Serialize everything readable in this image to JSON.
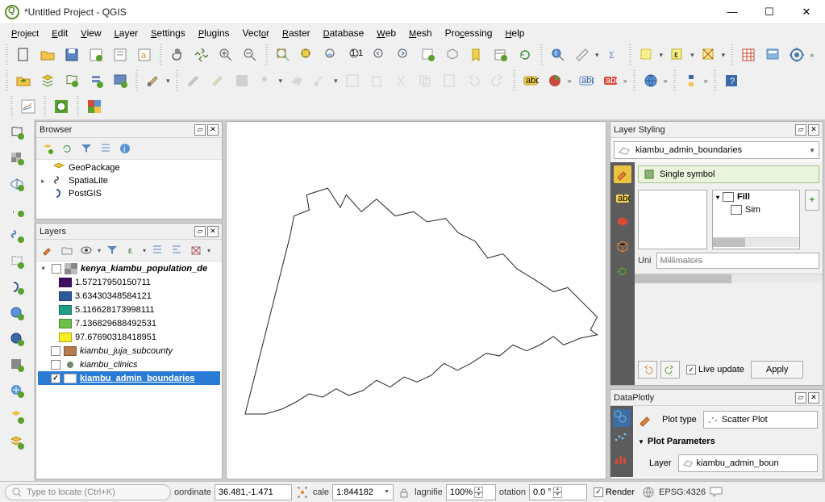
{
  "title": "*Untitled Project - QGIS",
  "menu": [
    "Project",
    "Edit",
    "View",
    "Layer",
    "Settings",
    "Plugins",
    "Vector",
    "Raster",
    "Database",
    "Web",
    "Mesh",
    "Processing",
    "Help"
  ],
  "browser": {
    "title": "Browser",
    "items": [
      {
        "icon": "geopackage",
        "label": "GeoPackage",
        "expandable": false
      },
      {
        "icon": "spatialite",
        "label": "SpatiaLite",
        "expandable": true
      },
      {
        "icon": "postgis",
        "label": "PostGIS",
        "expandable": false
      }
    ]
  },
  "layers": {
    "title": "Layers",
    "tree": [
      {
        "type": "group",
        "checked": false,
        "label": "kenya_kiambu_population_de",
        "style": "italic-bold",
        "icon": "raster"
      },
      {
        "type": "class",
        "color": "#3f1061",
        "label": "1.57217950150711"
      },
      {
        "type": "class",
        "color": "#2e5a9a",
        "label": "3.63430348584121"
      },
      {
        "type": "class",
        "color": "#1e9e87",
        "label": "5.116628173998111"
      },
      {
        "type": "class",
        "color": "#6cc04a",
        "label": "7.136829688492531"
      },
      {
        "type": "class",
        "color": "#f8ef22",
        "label": "97.67690318418951"
      },
      {
        "type": "layer",
        "checked": false,
        "label": "kiambu_juja_subcounty",
        "style": "italic",
        "icon": "poly",
        "color": "#b57b4a"
      },
      {
        "type": "layer",
        "checked": false,
        "label": "kiambu_clinics",
        "style": "italic",
        "icon": "point",
        "color": "#6f8a6a"
      },
      {
        "type": "layer",
        "checked": true,
        "label": "kiambu_admin_boundaries",
        "style": "sel",
        "icon": "poly",
        "color": "#ffffff"
      }
    ]
  },
  "styling": {
    "title": "Layer Styling",
    "layer": "kiambu_admin_boundaries",
    "mode": "Single symbol",
    "hier_root": "Fill",
    "hier_child": "Sim",
    "unit_label": "Uni",
    "unit_value": "Millimators",
    "live_update": "Live update",
    "apply": "Apply"
  },
  "dataplotly": {
    "title": "DataPlotly",
    "plot_type_label": "Plot type",
    "plot_type": "Scatter Plot",
    "section": "Plot Parameters",
    "layer_label": "Layer",
    "layer": "kiambu_admin_boun"
  },
  "status": {
    "locator_placeholder": "Type to locate (Ctrl+K)",
    "coord_label": "oordinate",
    "coord": "36.481,-1.471",
    "scale_label": "cale",
    "scale": "1:844182",
    "mag_label": "lagnifie",
    "mag": "100%",
    "rot_label": "otation",
    "rot": "0.0 °",
    "render": "Render",
    "crs": "EPSG:4326"
  }
}
